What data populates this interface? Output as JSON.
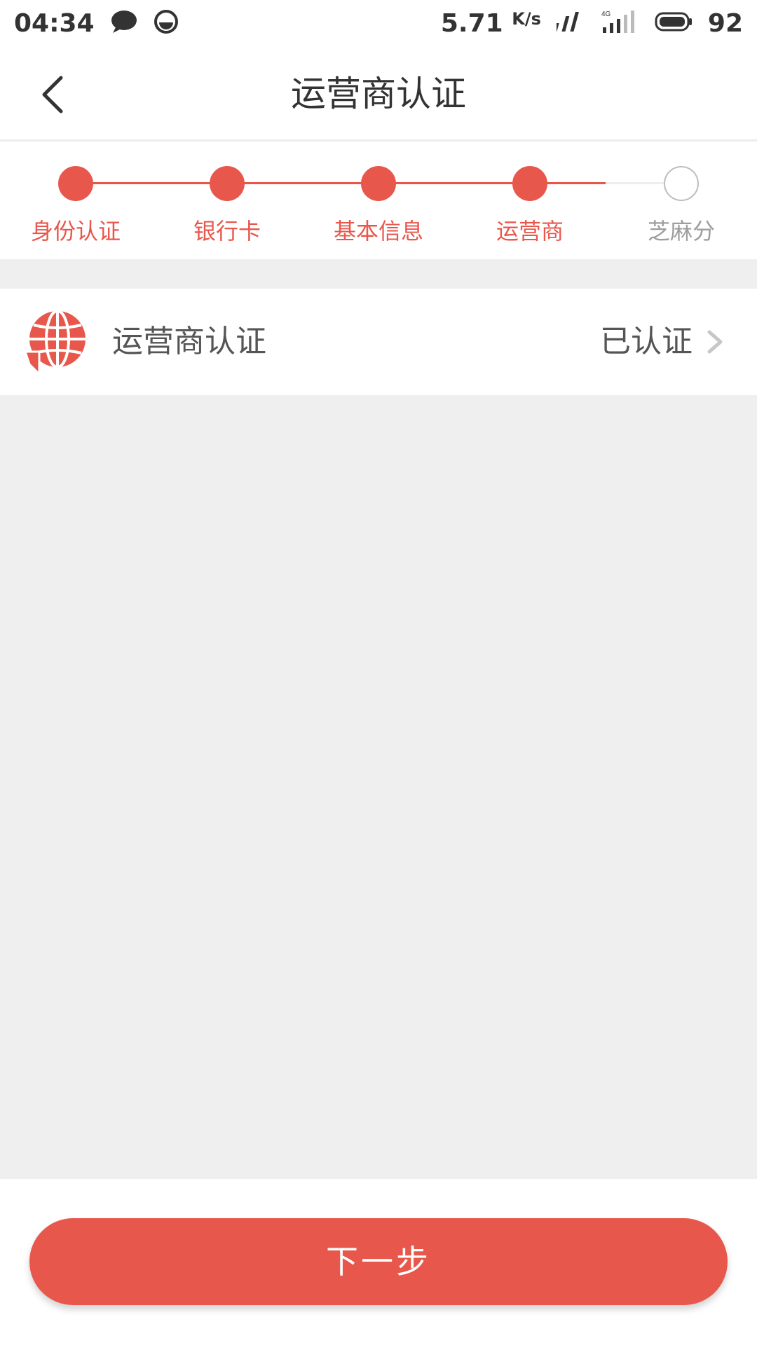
{
  "status_bar": {
    "time": "04:34",
    "net_speed": "5.71",
    "net_speed_unit": "K/s",
    "network_type": "4G",
    "battery_level": "92",
    "icons": [
      "message-icon",
      "app-notification-icon",
      "signal-arrows-icon",
      "cellular-signal-icon",
      "battery-icon"
    ]
  },
  "header": {
    "title": "运营商认证",
    "back_icon": "back-arrow-icon"
  },
  "steps": {
    "items": [
      {
        "label": "身份认证",
        "state": "done"
      },
      {
        "label": "银行卡",
        "state": "done"
      },
      {
        "label": "基本信息",
        "state": "done"
      },
      {
        "label": "运营商",
        "state": "current"
      },
      {
        "label": "芝麻分",
        "state": "pending"
      }
    ],
    "active_color": "#e8574b",
    "pending_color": "#bdbdbd"
  },
  "auth_item": {
    "icon": "globe-refresh-icon",
    "title": "运营商认证",
    "status": "已认证",
    "chevron_icon": "chevron-right-icon"
  },
  "footer": {
    "next_label": "下一步"
  },
  "colors": {
    "accent": "#e8574b",
    "background": "#efefef"
  }
}
